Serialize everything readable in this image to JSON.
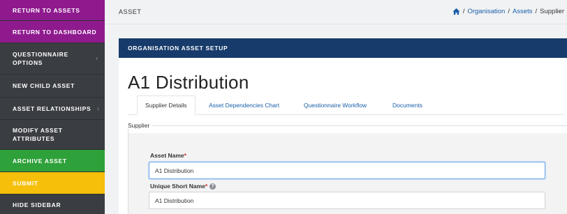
{
  "sidebar": {
    "items": [
      {
        "label": "RETURN TO ASSETS"
      },
      {
        "label": "RETURN TO DASHBOARD"
      },
      {
        "label": "QUESTIONNAIRE\nOPTIONS",
        "chevron": "‹"
      },
      {
        "label": "NEW CHILD ASSET"
      },
      {
        "label": "ASSET RELATIONSHIPS",
        "chevron": "‹"
      },
      {
        "label": "MODIFY ASSET\nATTRIBUTES"
      },
      {
        "label": "ARCHIVE ASSET"
      },
      {
        "label": "SUBMIT"
      },
      {
        "label": "HIDE SIDEBAR"
      }
    ]
  },
  "header": {
    "title": "ASSET",
    "breadcrumb": {
      "separator": "/",
      "items": [
        "Organisation",
        "Assets",
        "Supplier"
      ]
    }
  },
  "panel": {
    "heading": "ORGANISATION ASSET SETUP",
    "asset_title": "A1 Distribution",
    "tabs": [
      "Supplier Details",
      "Asset Dependencies Chart",
      "Questionnaire Workflow",
      "Documents"
    ],
    "active_tab": "Supplier Details",
    "fieldset_legend": "Supplier",
    "fields": {
      "asset_name": {
        "label": "Asset Name",
        "required": "*",
        "value": "A1 Distribution"
      },
      "short_name": {
        "label": "Unique Short Name",
        "required": "*",
        "value": "A1 Distribution"
      }
    }
  },
  "colors": {
    "purple": "#8e1a8e",
    "sidebar_dark": "#3a3d42",
    "green": "#2fa13a",
    "yellow": "#f5bf0a",
    "navy": "#173b6b",
    "link": "#1a5fa8"
  },
  "icons": {
    "home": "home-icon",
    "help": "question-icon",
    "chevron": "chevron-left-icon"
  }
}
